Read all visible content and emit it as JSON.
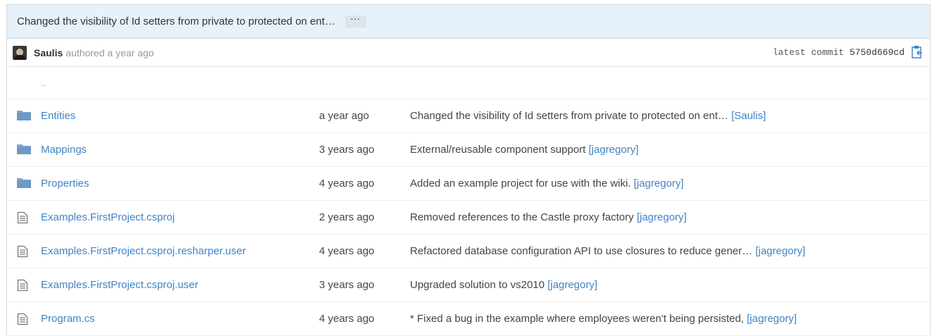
{
  "commit": {
    "title": "Changed the visibility of Id setters from private to protected on ent…",
    "more_label": "···",
    "author": "Saulis",
    "authored_text": "authored a year ago",
    "latest_label": "latest commit",
    "sha": "5750d669cd"
  },
  "parent_dir": "..",
  "files": [
    {
      "type": "folder",
      "name": "Entities",
      "age": "a year ago",
      "message": "Changed the visibility of Id setters from private to protected on ent…",
      "who": "[Saulis]"
    },
    {
      "type": "folder",
      "name": "Mappings",
      "age": "3 years ago",
      "message": "External/reusable component support",
      "who": "[jagregory]"
    },
    {
      "type": "folder",
      "name": "Properties",
      "age": "4 years ago",
      "message": "Added an example project for use with the wiki.",
      "who": "[jagregory]"
    },
    {
      "type": "file",
      "name": "Examples.FirstProject.csproj",
      "age": "2 years ago",
      "message": "Removed references to the Castle proxy factory",
      "who": "[jagregory]"
    },
    {
      "type": "file",
      "name": "Examples.FirstProject.csproj.resharper.user",
      "age": "4 years ago",
      "message": "Refactored database configuration API to use closures to reduce gener…",
      "who": "[jagregory]"
    },
    {
      "type": "file",
      "name": "Examples.FirstProject.csproj.user",
      "age": "3 years ago",
      "message": "Upgraded solution to vs2010",
      "who": "[jagregory]"
    },
    {
      "type": "file",
      "name": "Program.cs",
      "age": "4 years ago",
      "message": "* Fixed a bug in the example where employees weren't being persisted,",
      "who": "[jagregory]"
    }
  ],
  "colors": {
    "link": "#4183c4",
    "header_bg": "#e7f1fa",
    "folder_icon": "#80a6cd"
  },
  "icons": {
    "folder": "folder-icon",
    "file": "file-text-icon",
    "clipboard": "clipboard-icon"
  }
}
